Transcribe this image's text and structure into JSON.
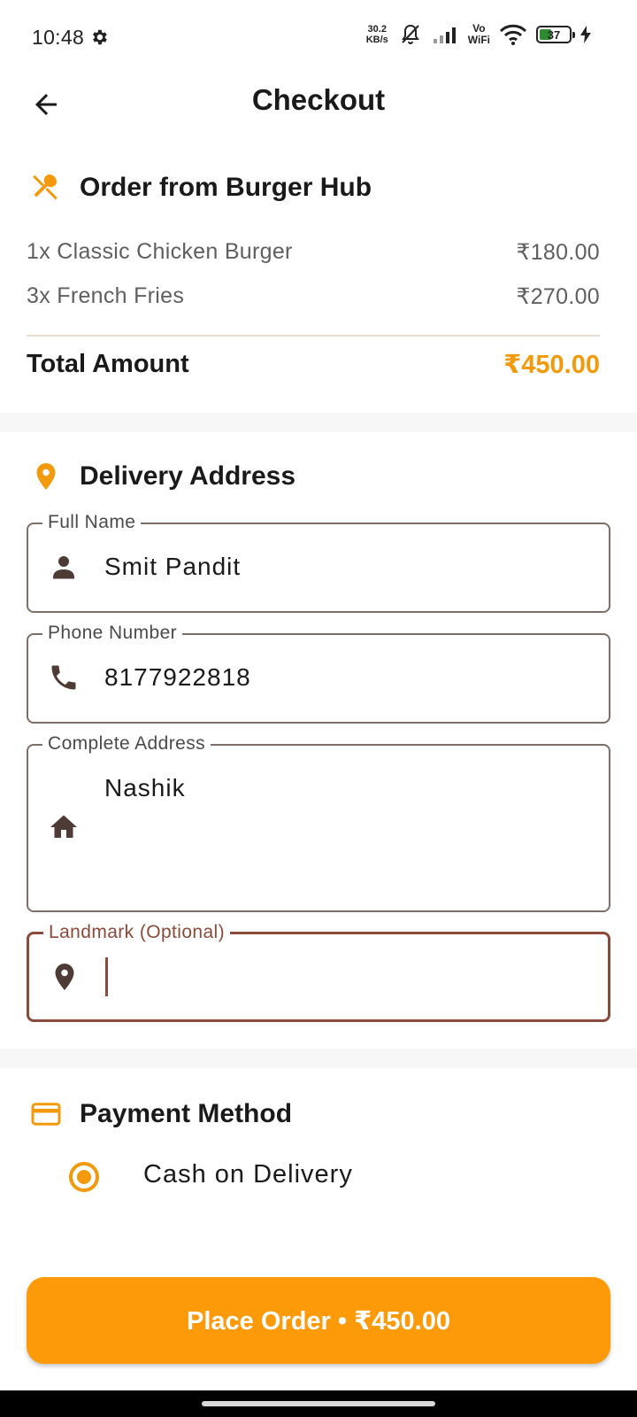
{
  "status_bar": {
    "time": "10:48",
    "net_speed_value": "30.2",
    "net_speed_unit": "KB/s",
    "vowifi_top": "Vo",
    "vowifi_bottom": "WiFi",
    "battery": "37"
  },
  "app_bar": {
    "title": "Checkout"
  },
  "order": {
    "title": "Order from Burger Hub",
    "items": [
      {
        "name": "1x Classic Chicken Burger",
        "price": "₹180.00"
      },
      {
        "name": "3x French Fries",
        "price": "₹270.00"
      }
    ],
    "total_label": "Total Amount",
    "total_value": "₹450.00"
  },
  "delivery": {
    "title": "Delivery Address",
    "full_name": {
      "label": "Full Name",
      "value": "Smit Pandit"
    },
    "phone": {
      "label": "Phone Number",
      "value": "8177922818"
    },
    "address": {
      "label": "Complete Address",
      "value": "Nashik"
    },
    "landmark": {
      "label": "Landmark (Optional)",
      "value": ""
    }
  },
  "payment": {
    "title": "Payment Method",
    "options": [
      {
        "label": "Cash on Delivery",
        "selected": true
      }
    ]
  },
  "place_order": {
    "label": "Place Order • ₹450.00"
  },
  "colors": {
    "accent": "#fd9a0a",
    "price_accent": "#f39a0c",
    "focus_border": "#8b4a3a",
    "field_icon": "#4e3b35"
  }
}
